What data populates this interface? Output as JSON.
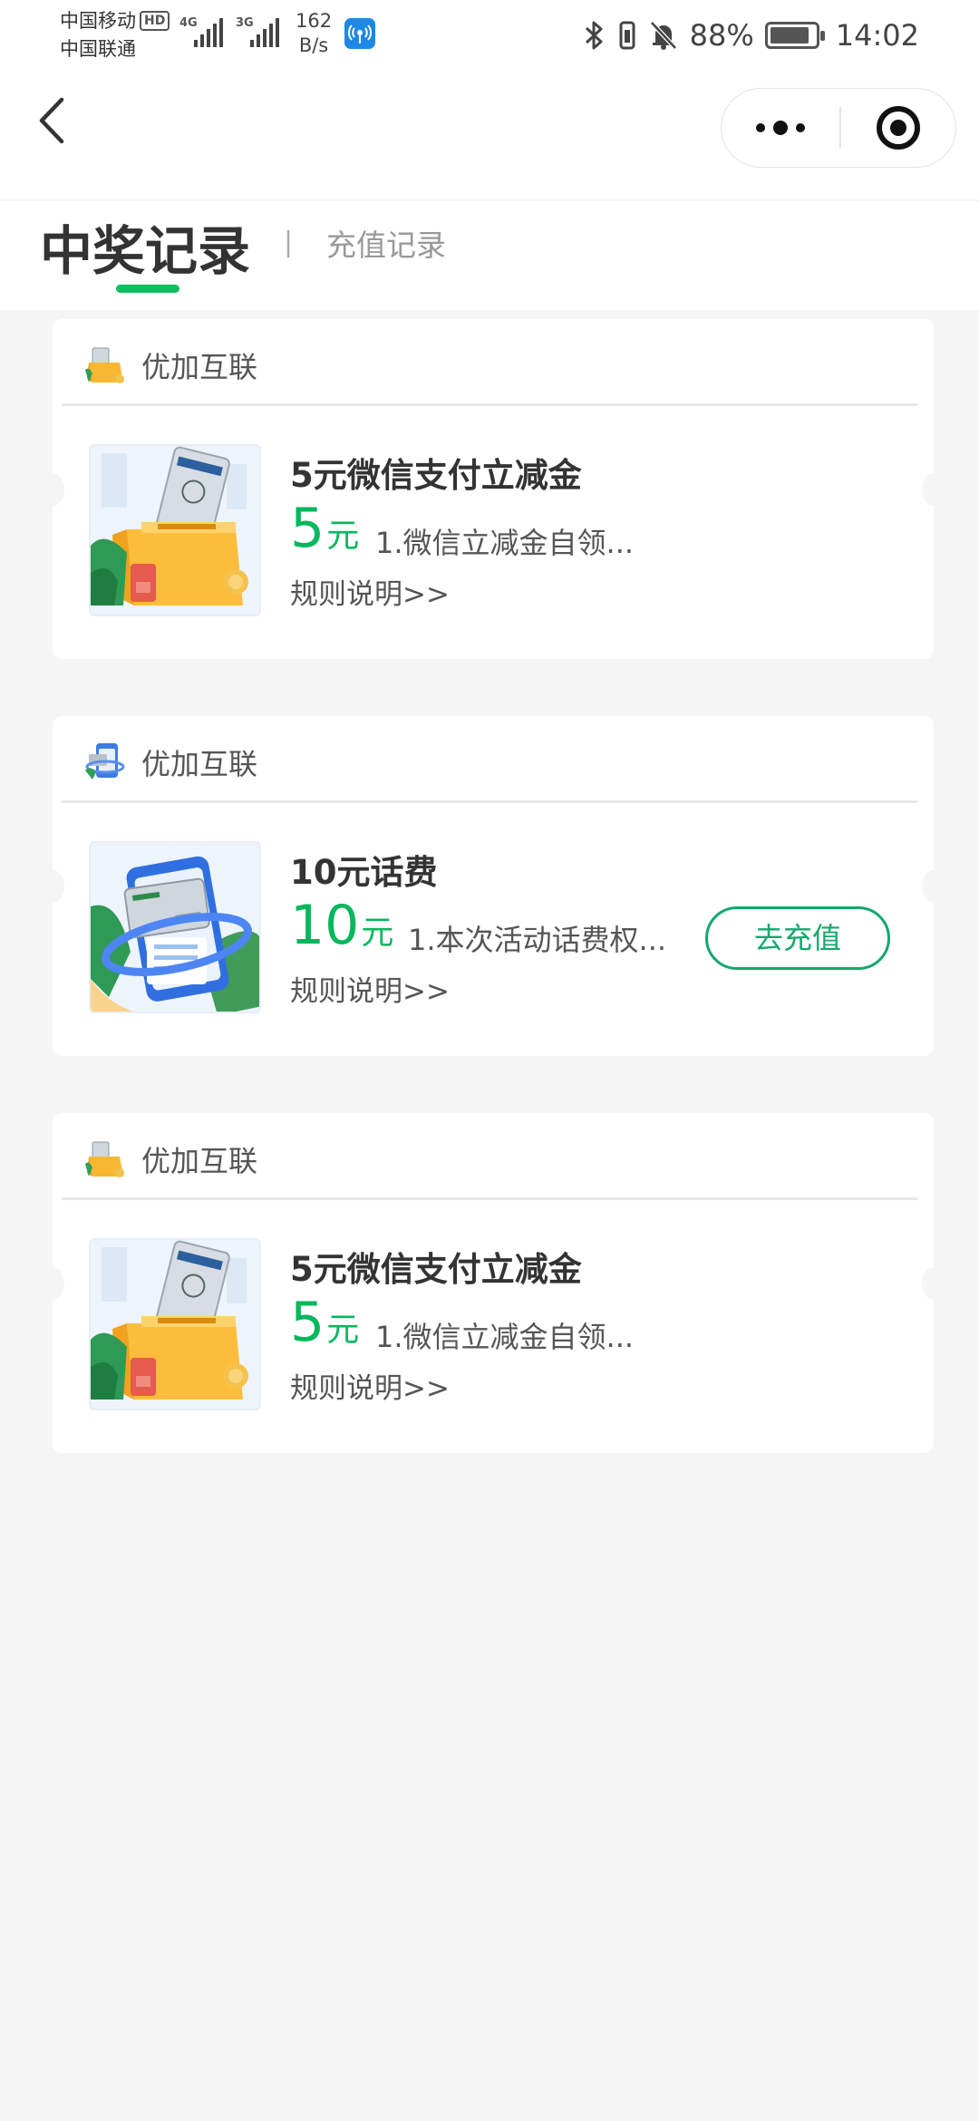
{
  "status_bar": {
    "carrier_1": "中国移动",
    "carrier_2": "中国联通",
    "hd_badge": "HD",
    "sim1_tag": "4G",
    "sim2_tag": "3G",
    "net_speed_value": "162",
    "net_speed_unit": "B/s",
    "battery_percent": "88%",
    "battery_level": 0.88,
    "time": "14:02"
  },
  "nav": {
    "back_icon": "chevron-left-icon",
    "more_icon": "more-dots-icon",
    "close_icon": "target-close-icon"
  },
  "tabs": {
    "active_label": "中奖记录",
    "divider": "|",
    "other_label": "充值记录"
  },
  "records": [
    {
      "merchant": "优加互联",
      "merchant_icon": "money-box-icon",
      "title": "5元微信支付立减金",
      "value": "5",
      "unit": "元",
      "desc": "1.微信立减金自领...",
      "rules": "规则说明>>"
    },
    {
      "merchant": "优加互联",
      "merchant_icon": "phone-card-icon",
      "title": "10元话费",
      "value": "10",
      "unit": "元",
      "desc": "1.本次活动话费权...",
      "rules": "规则说明>>",
      "action": "去充值"
    },
    {
      "merchant": "优加互联",
      "merchant_icon": "money-box-icon",
      "title": "5元微信支付立减金",
      "value": "5",
      "unit": "元",
      "desc": "1.微信立减金自领...",
      "rules": "规则说明>>"
    }
  ],
  "colors": {
    "accent_green": "#07c160",
    "value_green": "#07b75d",
    "button_green": "#12a86b",
    "page_background": "#f5f5f5"
  }
}
